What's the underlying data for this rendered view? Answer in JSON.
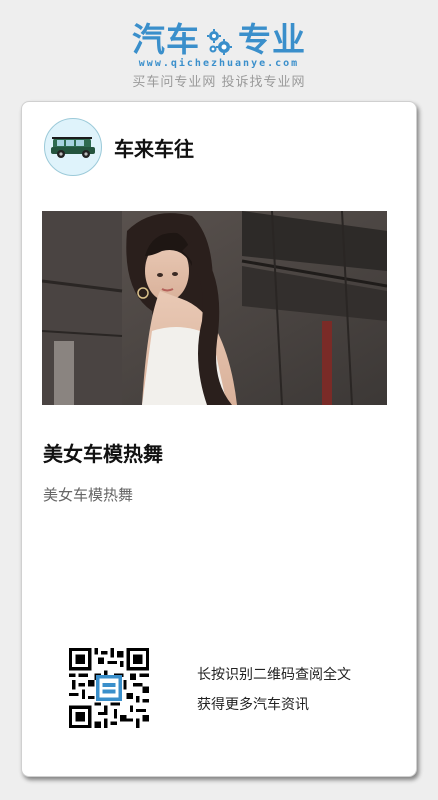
{
  "brand": {
    "name_left": "汽车",
    "name_right": "专业",
    "url": "www.qichezhuanye.com",
    "slogan": "买车问专业网 投诉找专业网",
    "accent": "#3a8fcb"
  },
  "author": {
    "name": "车来车往",
    "avatar_icon": "car-icon"
  },
  "article": {
    "image_icon": "photo-image",
    "title": "美女车模热舞",
    "summary": "美女车模热舞"
  },
  "qr": {
    "icon": "qr-code-icon",
    "line1": "长按识别二维码查阅全文",
    "line2": "获得更多汽车资讯"
  }
}
